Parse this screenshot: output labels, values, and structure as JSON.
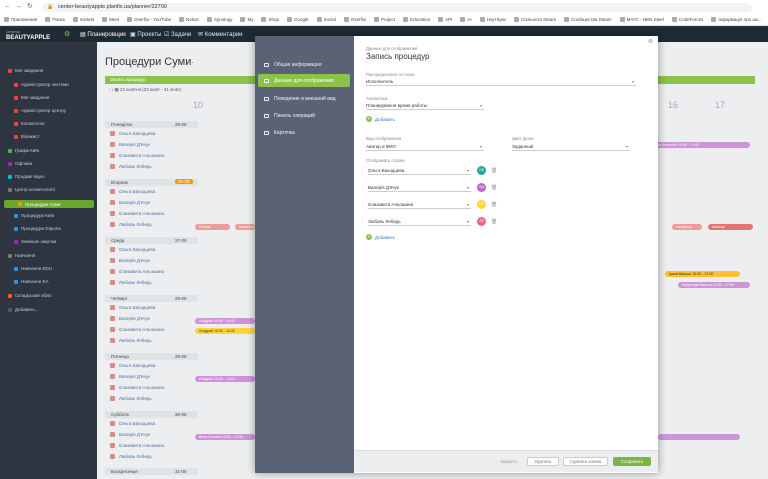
{
  "browser": {
    "url": "center-beautyapple.planfix.ua/planner/22700",
    "bookmarks": [
      "Приложения",
      "Поиск",
      "svetest",
      "Meet",
      "Overfixi - YouTube",
      "Notion",
      "Synology",
      "My",
      "Shop",
      "Google",
      "Social",
      "Overfixi",
      "Project",
      "Education",
      "API",
      "AI",
      "Ноутбуки",
      "Спільнота Steam",
      "Сообщества Steam",
      "МАГС - NBN Steel",
      "CodeForces",
      "Інформація про шк..."
    ]
  },
  "app": {
    "logo_small": "Сенатор",
    "logo": "BEAUTYAPPLE",
    "nav": [
      "Планировщик",
      "Проекты",
      "Задачи",
      "Комментарии"
    ],
    "colors": {
      "accent": "#8bc34a",
      "dark": "#1f2a33",
      "selected": "#6aa72e"
    }
  },
  "sidebar": {
    "items": [
      {
        "label": "Мої завдання",
        "color": "#f44336"
      },
      {
        "label": "Адміністратор системи",
        "color": "#f44336"
      },
      {
        "label": "Мої завдання",
        "color": "#f44336"
      },
      {
        "label": "Адміністратор центру",
        "color": "#f44336"
      },
      {
        "label": "Косметолог",
        "color": "#f44336"
      },
      {
        "label": "Візажист",
        "color": "#f44336"
      },
      {
        "label": "Графік Київ",
        "color": "#4caf50"
      },
      {
        "label": "Офлайн",
        "color": "#9c27b0"
      },
      {
        "label": "Продажі відео",
        "color": "#00bcd4"
      },
      {
        "label": "Центр косметології",
        "color": "#777"
      },
      {
        "label": "Процедури Суми",
        "color": "#ff9800"
      },
      {
        "label": "Процедури Київ",
        "color": "#2196f3"
      },
      {
        "label": "Процедури Європа",
        "color": "#2196f3"
      },
      {
        "label": "Зовнішні закупки",
        "color": "#9c27b0"
      },
      {
        "label": "Навчання",
        "color": "#777"
      },
      {
        "label": "Навчання EDU",
        "color": "#2196f3"
      },
      {
        "label": "Навчання EA",
        "color": "#2196f3"
      },
      {
        "label": "Складський облік",
        "color": "#ff5722"
      },
      {
        "label": "Добавить...",
        "color": "#555"
      }
    ]
  },
  "planner": {
    "title": "Процедури Суми",
    "greenbar": "Запись процедур",
    "daterange": "22 жовтня (23 жовт - 31 жовт)",
    "hours": [
      "10",
      "16",
      "17"
    ],
    "days": [
      {
        "name": "Понеділок",
        "date": "25-05",
        "people": [
          "Ольга Баходцева",
          "Валерія Д'ячук",
          "Єлизавета Альошина",
          "Любовь Лебедь"
        ]
      },
      {
        "name": "Вторник",
        "date": "26-05",
        "people": [
          "Ольга Баходцева",
          "Валерія Д'ячук",
          "Єлизавета Альошина",
          "Любовь Лебедь"
        ]
      },
      {
        "name": "Среда",
        "date": "27-05",
        "people": [
          "Ольга Баходцева",
          "Валерія Д'ячук",
          "Єлизавета Альошина",
          "Любовь Лебедь"
        ]
      },
      {
        "name": "Четверг",
        "date": "28-05",
        "people": [
          "Ольга Баходцева",
          "Валерія Д'ячук",
          "Єлизавета Альошина",
          "Любовь Лебедь"
        ]
      },
      {
        "name": "Пятница",
        "date": "29-05",
        "people": [
          "Ольга Баходцева",
          "Валерія Д'ячук",
          "Єлизавета Альошина",
          "Любовь Лебедь"
        ]
      },
      {
        "name": "Суббота",
        "date": "30-05",
        "people": [
          "Ольга Баходцева",
          "Валерія Д'ячук",
          "Єлизавета Альошина",
          "Любовь Лебедь"
        ]
      },
      {
        "name": "Воскресенье",
        "date": "31-05",
        "people": []
      }
    ],
    "bars": {
      "b1": "Лозинська Антоніна 10:00 - 17:00",
      "b2": "Яхтинє",
      "b3": "Ітклубгна",
      "b4": "Ітклубгна",
      "b5": "Іспанця",
      "b6": "Ірина Василь 10:00 - 17:00",
      "b7": "Коррекція Европа 10:00 - 17:00",
      "b8": "Лоздрий 10:00 - 14:00",
      "b9": "Лоздрий 10:00 - 14:00",
      "b10": "Лоздрий 10:00 - 14:00",
      "b11": "Воіге Оксана 10:00 - 12:00"
    }
  },
  "modal": {
    "nav": [
      "Общая информация",
      "Данные для отображения",
      "Поведение и внешний вид",
      "Панель операций",
      "Карточка"
    ],
    "subtitle": "Данные для отображения",
    "title": "Запись процедур",
    "f1_label": "Распределение по полю",
    "f1_value": "Исполнитель",
    "f2_label": "Аналитика",
    "f2_value": "Планирування время работы",
    "add1": "Добавить",
    "f3_label": "Вид отображения",
    "f3_value": "Аватар и ФИО",
    "f4_label": "Цвет фона",
    "f4_value": "Заданный",
    "f5_label": "Отображать строки",
    "rows": [
      {
        "name": "Ольга Баходцева",
        "initials": "ОБ",
        "color": "#26a69a"
      },
      {
        "name": "Валерія Д'ячук",
        "initials": "ВД",
        "color": "#ba68c8"
      },
      {
        "name": "Єлизавета Альошина",
        "initials": "ЄА",
        "color": "#fdd835"
      },
      {
        "name": "Любовь Лебедь",
        "initials": "ЛЛ",
        "color": "#f06292"
      }
    ],
    "add2": "Добавить",
    "buttons": {
      "close": "Закрыть",
      "delete": "Удалить",
      "copy": "Сделать копию",
      "save": "Сохранить"
    }
  }
}
